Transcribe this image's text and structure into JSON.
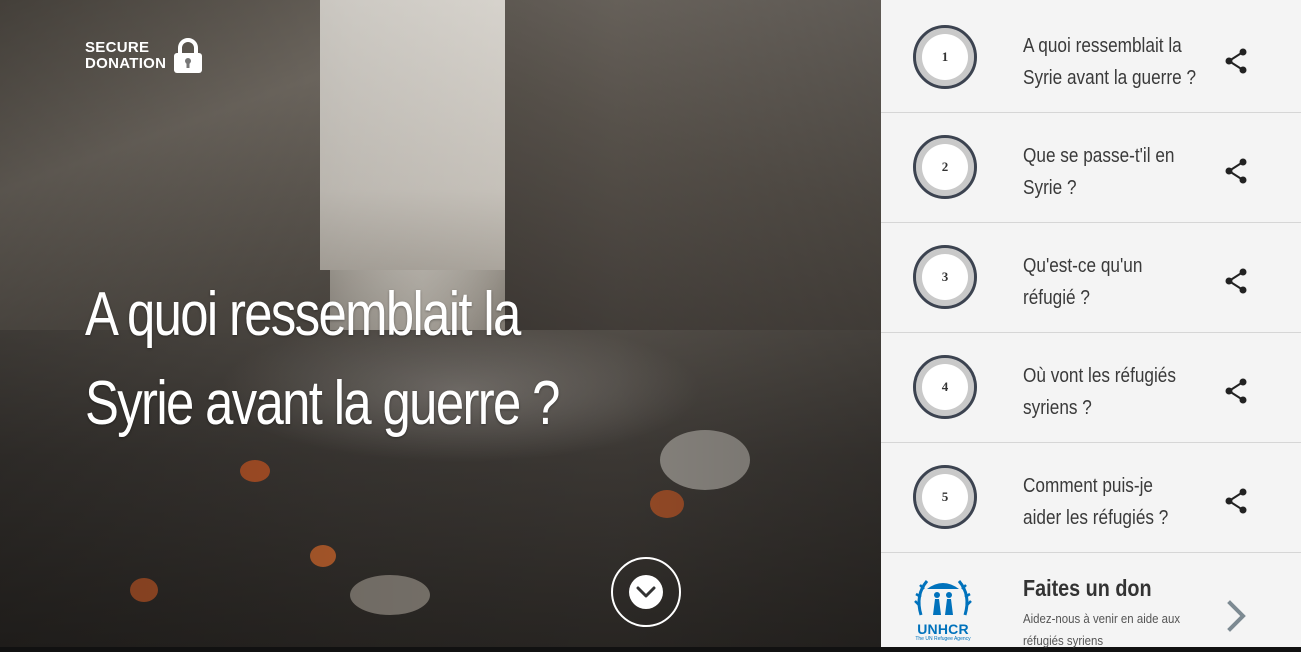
{
  "badge": {
    "line1": "SECURE",
    "line2": "DONATION",
    "icon": "lock-icon"
  },
  "hero": {
    "title_line1": "A quoi ressemblait la",
    "title_line2": "Syrie avant la guerre ?"
  },
  "scroll": {
    "icon": "chevron-down-icon"
  },
  "sidebar": {
    "items": [
      {
        "number": "1",
        "line1": "A quoi ressemblait la",
        "line2": "Syrie avant la guerre ?",
        "icon": "share-icon"
      },
      {
        "number": "2",
        "line1": "Que se passe-t'il en",
        "line2": "Syrie ?",
        "icon": "share-icon"
      },
      {
        "number": "3",
        "line1": "Qu'est-ce qu'un",
        "line2": "réfugié ?",
        "icon": "share-icon"
      },
      {
        "number": "4",
        "line1": "Où vont les réfugiés",
        "line2": "syriens ?",
        "icon": "share-icon"
      },
      {
        "number": "5",
        "line1": "Comment puis-je",
        "line2": "aider les réfugiés ?",
        "icon": "share-icon"
      }
    ]
  },
  "donate": {
    "logo_word": "UNHCR",
    "logo_tagline": "The UN Refugee Agency",
    "title": "Faites un don",
    "subtitle_line1": "Aidez-nous à venir en aide aux",
    "subtitle_line2": "réfugiés syriens",
    "icon": "chevron-right-icon"
  },
  "colors": {
    "sidebar_bg": "#f4f4f4",
    "ring": "#3c4350",
    "unhcr_blue": "#0072bc"
  }
}
